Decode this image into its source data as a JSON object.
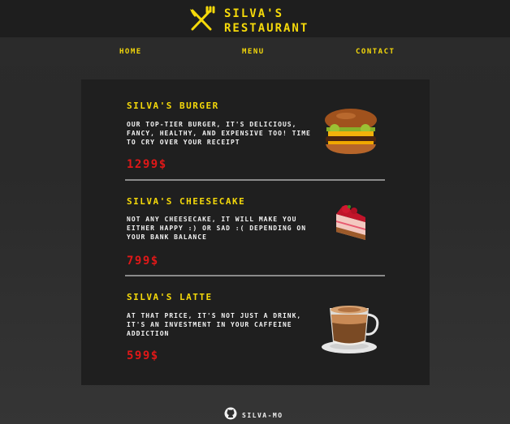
{
  "header": {
    "brand_line1": "Silva's",
    "brand_line2": "Restaurant",
    "logo_icon": "fork-knife-icon"
  },
  "nav": {
    "home": "Home",
    "menu": "Menu",
    "contact": "Contact"
  },
  "menu": {
    "items": [
      {
        "title": "Silva's Burger",
        "desc": "Our top-tier burger, it's delicious, fancy, healthy, and expensive too! Time to cry over your receipt",
        "price": "1299$",
        "image": "burger-image"
      },
      {
        "title": "Silva's Cheesecake",
        "desc": "Not any cheesecake, it will make you either happy :) or sad :( depending on your bank balance",
        "price": "799$",
        "image": "cheesecake-image"
      },
      {
        "title": "Silva's Latte",
        "desc": "At that price, it's not just a drink, it's an investment in your caffeine addiction",
        "price": "599$",
        "image": "latte-image"
      }
    ]
  },
  "footer": {
    "label": "Silva-Mo",
    "icon": "github-icon"
  },
  "colors": {
    "accent": "#f5d90a",
    "price": "#e01818",
    "card": "#1f1f1f"
  }
}
